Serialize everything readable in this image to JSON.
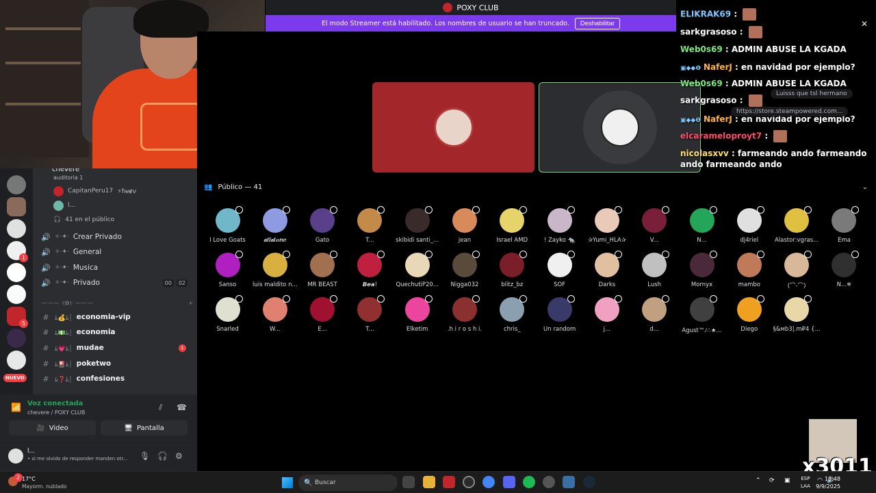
{
  "window": {
    "title": "POXY CLUB",
    "streamer_banner": "El modo Streamer está habilitado. Los nombres de usuario se han truncado.",
    "streamer_button": "Deshabilitar"
  },
  "voice_channel": {
    "name": "chevere",
    "sub": "auditoria 1",
    "users": [
      {
        "name": "CapitanPeru17",
        "tag": "⚡ɦᵾɇѵ"
      },
      {
        "name": "l..."
      }
    ],
    "audience_label": "41 en el público"
  },
  "channels": [
    {
      "type": "voice",
      "emoji": "✧·✦·",
      "name": "Crear Privado"
    },
    {
      "type": "voice",
      "emoji": "✧·✦·",
      "name": "General"
    },
    {
      "type": "voice",
      "emoji": "✧·✦·",
      "name": "Musica"
    },
    {
      "type": "voice",
      "emoji": "✧·✦·",
      "name": "Privado",
      "counts": [
        "00",
        "02"
      ]
    }
  ],
  "category_divider": "—·—— ·(✿)· ——·—",
  "text_channels": [
    {
      "name": "economia-vip",
      "emoji": "ﾑ💰ﾑ┊"
    },
    {
      "name": "economia",
      "emoji": "ﾑ💵ﾑ┊"
    },
    {
      "name": "mudae",
      "emoji": "ﾑ💗ﾑ┊",
      "unread": "1"
    },
    {
      "name": "poketwo",
      "emoji": "ﾑ🎴ﾑ┊"
    },
    {
      "name": "confesiones",
      "emoji": "ﾑ❓ﾑ┊"
    }
  ],
  "server_badges": {
    "one": "1",
    "five": "5",
    "nuevo": "NUEVO"
  },
  "voice_panel": {
    "status": "Voz conectada",
    "sub": "chevere / POXY CLUB",
    "video": "Video",
    "screen": "Pantalla"
  },
  "user_panel": {
    "name": "l...",
    "status": "• si me olvido de responder manden otr..."
  },
  "stage": {
    "publico_label": "Público — 41"
  },
  "audience": [
    {
      "name": "I Love Goats",
      "color": "#6fb7c9"
    },
    {
      "name": "𝒂𝒕𝒍𝒂𝒕𝒐𝒏𝒆",
      "color": "#8f9be0"
    },
    {
      "name": "Gato",
      "color": "#5a3f8a"
    },
    {
      "name": "T...",
      "color": "#c48a4a"
    },
    {
      "name": "skibidi santi_...",
      "color": "#3a2a2a"
    },
    {
      "name": "jean",
      "color": "#d88a5a"
    },
    {
      "name": "Israel AMD",
      "color": "#e6d36a"
    },
    {
      "name": "! Zayko 🐀",
      "color": "#c9b7c9"
    },
    {
      "name": "✰Yumi_HLA✰",
      "color": "#e9c9b7"
    },
    {
      "name": "V...",
      "color": "#7a1f3a"
    },
    {
      "name": "N...",
      "color": "#23a55a"
    },
    {
      "name": "dj4riel",
      "color": "#e0e0e0"
    },
    {
      "name": "Alastor:vgras...",
      "color": "#e0c040"
    },
    {
      "name": "Ema",
      "color": "#7a7a7a"
    },
    {
      "name": "Sanso",
      "color": "#b020c0"
    },
    {
      "name": "luis maldito n...",
      "color": "#d8b040"
    },
    {
      "name": "MR BEAST",
      "color": "#a07050"
    },
    {
      "name": "𝘽𝙚𝙖!",
      "color": "#c02040"
    },
    {
      "name": "QuechutiP20...",
      "color": "#e8d8b8"
    },
    {
      "name": "Nigga032",
      "color": "#5a4a3a"
    },
    {
      "name": "blitz_bz",
      "color": "#7a1f2a"
    },
    {
      "name": "SOF",
      "color": "#f0f0f0"
    },
    {
      "name": "Darks",
      "color": "#e0c0a0"
    },
    {
      "name": "Lush",
      "color": "#c0c0c0"
    },
    {
      "name": "Mornyx",
      "color": "#4a2a3a"
    },
    {
      "name": "mambo",
      "color": "#c07a5a"
    },
    {
      "name": "(⌒-⌒)",
      "color": "#d8b898"
    },
    {
      "name": "N...✵",
      "color": "#303030"
    },
    {
      "name": "Snarled",
      "color": "#e0e0d0"
    },
    {
      "name": "W...",
      "color": "#e08070"
    },
    {
      "name": "E...",
      "color": "#a01030"
    },
    {
      "name": "T...",
      "color": "#903030"
    },
    {
      "name": "Elketim",
      "color": "#eb459e"
    },
    {
      "name": ".h i r o s h i.",
      "color": "#8a3030"
    },
    {
      "name": "chris_",
      "color": "#8aa0b0"
    },
    {
      "name": "Un random",
      "color": "#3a3a6a"
    },
    {
      "name": "j...",
      "color": "#f0a0c0"
    },
    {
      "name": "d...",
      "color": "#c0a080"
    },
    {
      "name": "Agust™ﾉ∴★...",
      "color": "#404040"
    },
    {
      "name": "Diego",
      "color": "#f0a020"
    },
    {
      "name": "§&мb3|.m₽4 {...",
      "color": "#e8d8a8"
    }
  ],
  "chat": [
    {
      "user": "ELIKRAK69",
      "color": "#7ec8ff",
      "text": "",
      "emote": true
    },
    {
      "user": "sarkgrasoso",
      "color": "#ffffff",
      "text": "",
      "emote": true
    },
    {
      "user": "Web0s69",
      "color": "#7fe67f",
      "text": "ADMIN ABUSE LA KGADA"
    },
    {
      "user": "NaferJ",
      "color": "#ffb347",
      "text": "en navidad por ejemplo?",
      "badges": "▣◆◆❶"
    },
    {
      "user": "Web0s69",
      "color": "#7fe67f",
      "text": "ADMIN ABUSE LA KGADA"
    },
    {
      "user": "sarkgrasoso",
      "color": "#ffffff",
      "text": "",
      "emote": true
    },
    {
      "user": "NaferJ",
      "color": "#ffb347",
      "text": "en navidad por ejemplo?",
      "badges": "▣◆◆❶"
    },
    {
      "user": "elcarameloproyt7",
      "color": "#ff4d6d",
      "text": "",
      "emote": true
    },
    {
      "user": "nicolasxvv",
      "color": "#ffe066",
      "text": "farmeando ando farmeando ando farmeando ando"
    }
  ],
  "chat_popups": {
    "one": "Luisss que tsl hermano",
    "two": "https://store.steampowered.com..."
  },
  "overlay_counter": "x3011",
  "taskbar": {
    "temp": "17°C",
    "weather": "Mayorm. nublado",
    "weather_badge": "2",
    "search": "Buscar",
    "lang_top": "ESP",
    "lang_bottom": "LAA",
    "time": "18:48",
    "date": "9/9/2025"
  }
}
